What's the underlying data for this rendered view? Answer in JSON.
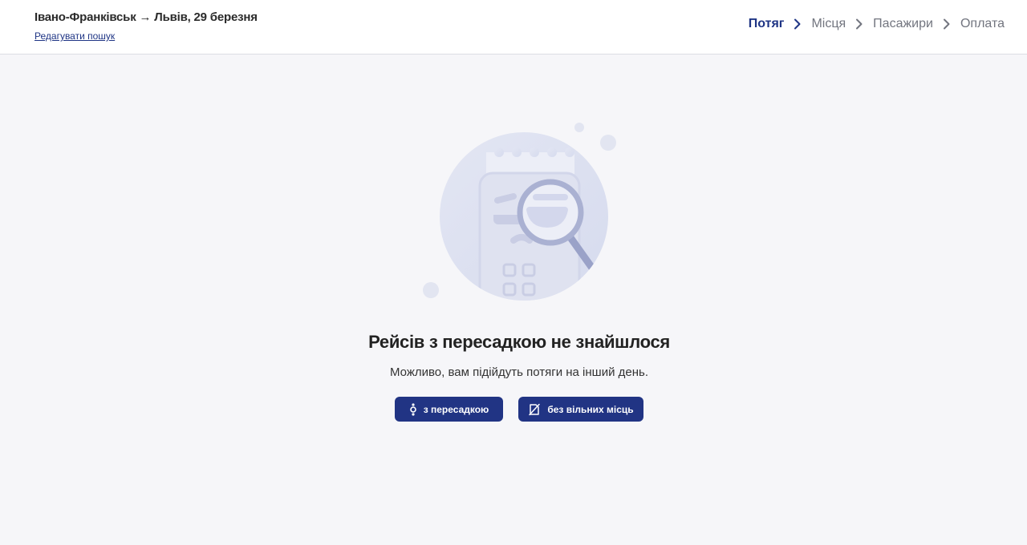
{
  "header": {
    "route": "Івано-Франківськ → Львів, 29 березня",
    "edit_label": "Редагувати пошук",
    "steps": [
      {
        "label": "Потяг",
        "active": true
      },
      {
        "label": "Місця",
        "active": false
      },
      {
        "label": "Пасажири",
        "active": false
      },
      {
        "label": "Оплата",
        "active": false
      }
    ]
  },
  "empty_state": {
    "illustration_icon": "ticket-search-icon",
    "title": "Рейсів з пересадкою не знайшлося",
    "subtitle": "Можливо, вам підійдуть потяги на інший день."
  },
  "filters": {
    "transfer_label": "з пересадкою",
    "transfer_icon": "transfer-icon",
    "no_seats_label": "без вільних місць",
    "no_seats_icon": "no-seats-icon"
  },
  "colors": {
    "primary": "#213484",
    "background": "#f6f6f9",
    "step_inactive": "#72757f"
  }
}
